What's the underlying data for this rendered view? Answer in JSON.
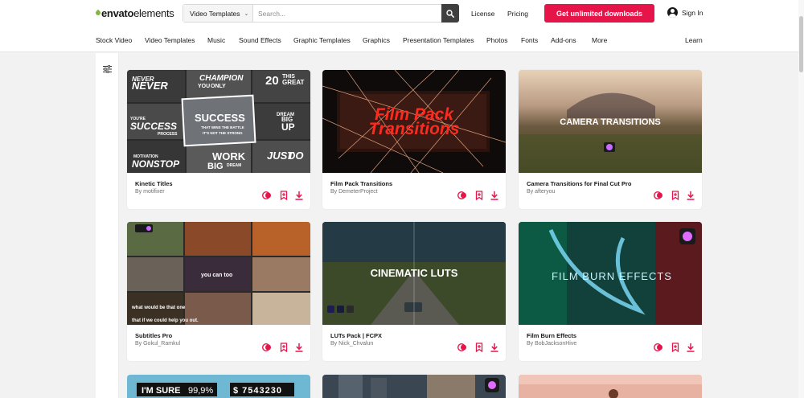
{
  "header": {
    "logo_part1": "envato",
    "logo_part2": "elements",
    "search": {
      "category": "Video Templates",
      "placeholder": "Search..."
    },
    "links": {
      "license": "License",
      "pricing": "Pricing"
    },
    "cta": "Get unlimited downloads",
    "signin": "Sign In"
  },
  "nav": {
    "items": [
      "Stock Video",
      "Video Templates",
      "Music",
      "Sound Effects",
      "Graphic Templates",
      "Graphics",
      "Presentation Templates",
      "Photos",
      "Fonts",
      "Add-ons",
      "More",
      "Learn"
    ]
  },
  "cards": [
    {
      "title": "Kinetic Titles",
      "author": "By motifixer",
      "thumb_words": [
        "NEVER",
        "NEVER",
        "CHAMPION",
        "ONLY",
        "YOU",
        "20",
        "THIS",
        "GREAT",
        "YOU'RE",
        "SUCCESS",
        "PROCESS",
        "SUCCESS",
        "THAT WINS THE BATTLE",
        "IT'S NOT THE STRONG",
        "DREAM",
        "BIG",
        "UP",
        "MOTIVATION",
        "NONSTOP",
        "WORK",
        "BIG",
        "DREAM",
        "JUST",
        "DO"
      ]
    },
    {
      "title": "Film Pack Transitions",
      "author": "By DemeterProject",
      "thumb_words": [
        "Film Pack",
        "Transitions"
      ]
    },
    {
      "title": "Camera Transitions for Final Cut Pro",
      "author": "By afteryou",
      "thumb_words": [
        "CAMERA TRANSITIONS"
      ]
    },
    {
      "title": "Subtitles Pro",
      "author": "By Gokul_Ramkul",
      "thumb_words": [
        "you can too",
        "what would be that one",
        "that if we could help you out."
      ]
    },
    {
      "title": "LUTs Pack | FCPX",
      "author": "By Nick_Chvalun",
      "thumb_words": [
        "CINEMATIC LUTS"
      ]
    },
    {
      "title": "Film Burn Effects",
      "author": "By BobJacksonHive",
      "thumb_words": [
        "FILM BURN EFFECTS"
      ]
    }
  ],
  "partial_cards": {
    "first": [
      "I'M SURE",
      "99,9%",
      "$ 7543230"
    ]
  },
  "colors": {
    "accent": "#e5154a",
    "brand_green": "#82b541",
    "page_bg": "#f2f2f2"
  }
}
